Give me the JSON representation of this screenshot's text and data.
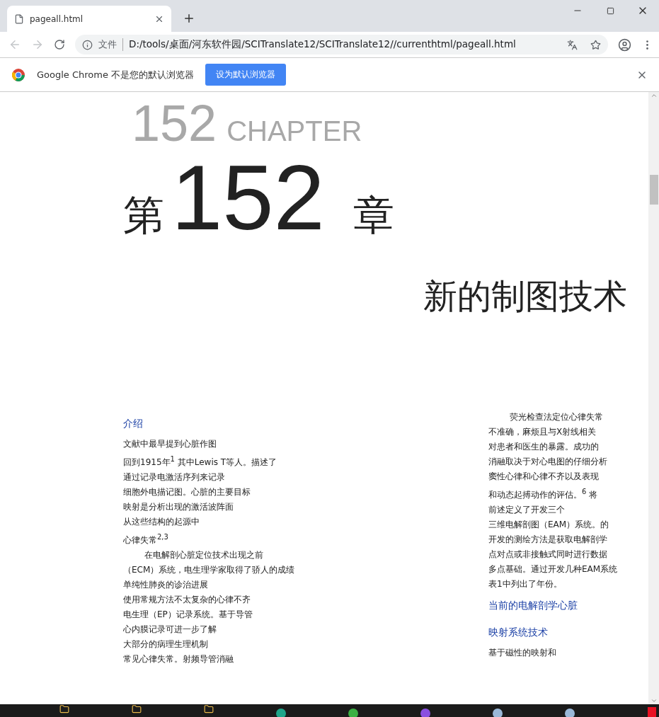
{
  "browser": {
    "tab": {
      "title": "pageall.html"
    },
    "nav": {
      "back_disabled": true,
      "forward_disabled": true
    },
    "address": {
      "scheme_label": "文件",
      "url": "D:/tools/桌面/河东软件园/SCITranslate12/SCITranslate12//currenthtml/pageall.html"
    }
  },
  "infobar": {
    "message": "Google Chrome 不是您的默认浏览器",
    "button": "设为默认浏览器"
  },
  "page": {
    "chapter_backdrop": {
      "number": "152",
      "word": "CHAPTER"
    },
    "chapter": {
      "prefix": "第",
      "number": "152",
      "suffix": "章"
    },
    "title": "新的制图技术",
    "left_column": [
      {
        "kind": "heading",
        "text": "介绍"
      },
      {
        "kind": "line",
        "text": "文献中最早提到心脏作图"
      },
      {
        "kind": "line",
        "text": "回到1915年$^{1}$ 其中Lewis T等人。描述了"
      },
      {
        "kind": "line",
        "text": "通过记录电激活序列来记录"
      },
      {
        "kind": "line",
        "text": "细胞外电描记图。心脏的主要目标"
      },
      {
        "kind": "line",
        "text": "映射是分析出现的激活波阵面"
      },
      {
        "kind": "line",
        "text": "从这些结构的起源中"
      },
      {
        "kind": "line",
        "text": "心律失常$^{2,3}$"
      },
      {
        "kind": "indent",
        "text": "在电解剖心脏定位技术出现之前"
      },
      {
        "kind": "line",
        "text": "（ECM）系统，电生理学家取得了骄人的成绩"
      },
      {
        "kind": "line",
        "text": "单纯性肺炎的诊治进展"
      },
      {
        "kind": "line",
        "text": "使用常规方法不太复杂的心律不齐"
      },
      {
        "kind": "line",
        "text": "电生理（EP）记录系统。基于导管"
      },
      {
        "kind": "line",
        "text": "心内膜记录可进一步了解"
      },
      {
        "kind": "line",
        "text": "大部分的病理生理机制"
      },
      {
        "kind": "line",
        "text": "常见心律失常。射频导管消融"
      }
    ],
    "right_column": [
      {
        "kind": "indent",
        "text": "荧光检查法定位心律失常"
      },
      {
        "kind": "line",
        "text": "不准确，麻烦且与X射线相关"
      },
      {
        "kind": "line",
        "text": "对患者和医生的暴露。成功的"
      },
      {
        "kind": "line",
        "text": "消融取决于对心电图的仔细分析"
      },
      {
        "kind": "line",
        "text": "窦性心律和心律不齐以及表现"
      },
      {
        "kind": "line",
        "text": "和动态起搏动作的评估。$^{6}$ 将"
      },
      {
        "kind": "line",
        "text": "前述定义了开发三个"
      },
      {
        "kind": "line",
        "text": "三维电解剖图（EAM）系统。的"
      },
      {
        "kind": "line",
        "text": "开发的测绘方法是获取电解剖学"
      },
      {
        "kind": "line",
        "text": "点对点或非接触式同时进行数据"
      },
      {
        "kind": "line",
        "text": "多点基础。通过开发几种EAM系统"
      },
      {
        "kind": "line",
        "text": "表1中列出了年份。"
      },
      {
        "kind": "heading",
        "text": "当前的电解剖学心脏"
      },
      {
        "kind": "heading",
        "text": "映射系统技术"
      },
      {
        "kind": "line",
        "text": "基于磁性的映射和"
      }
    ]
  }
}
